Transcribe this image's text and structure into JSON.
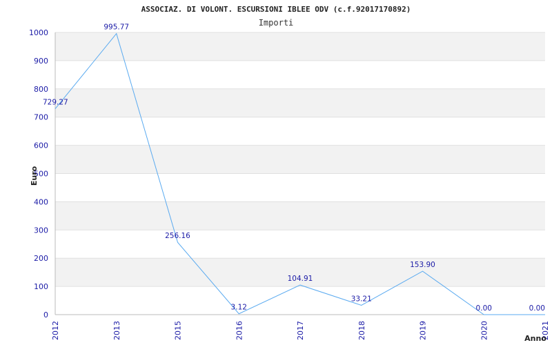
{
  "chart_data": {
    "type": "line",
    "title": "ASSOCIAZ. DI VOLONT. ESCURSIONI IBLEE ODV (c.f.92017170892)",
    "subtitle": "Importi",
    "xlabel": "Anno",
    "ylabel": "Euro",
    "x": [
      "2012",
      "2013",
      "2015",
      "2016",
      "2017",
      "2018",
      "2019",
      "2020",
      "2021"
    ],
    "series": [
      {
        "values": [
          729.27,
          995.77,
          256.16,
          3.12,
          104.91,
          33.21,
          153.9,
          0.0,
          0.0
        ],
        "labels": [
          "729.27",
          "995.77",
          "256.16",
          "3.12",
          "104.91",
          "33.21",
          "153.90",
          "0.00",
          "0.00"
        ]
      }
    ],
    "ylim": [
      0,
      1000
    ],
    "yticks": [
      0,
      100,
      200,
      300,
      400,
      500,
      600,
      700,
      800,
      900,
      1000
    ],
    "grid": "horizontal bands",
    "colors": {
      "line": "#5aaaf0",
      "band": "#f2f2f2",
      "tick_text": "#1a1aa6"
    }
  }
}
